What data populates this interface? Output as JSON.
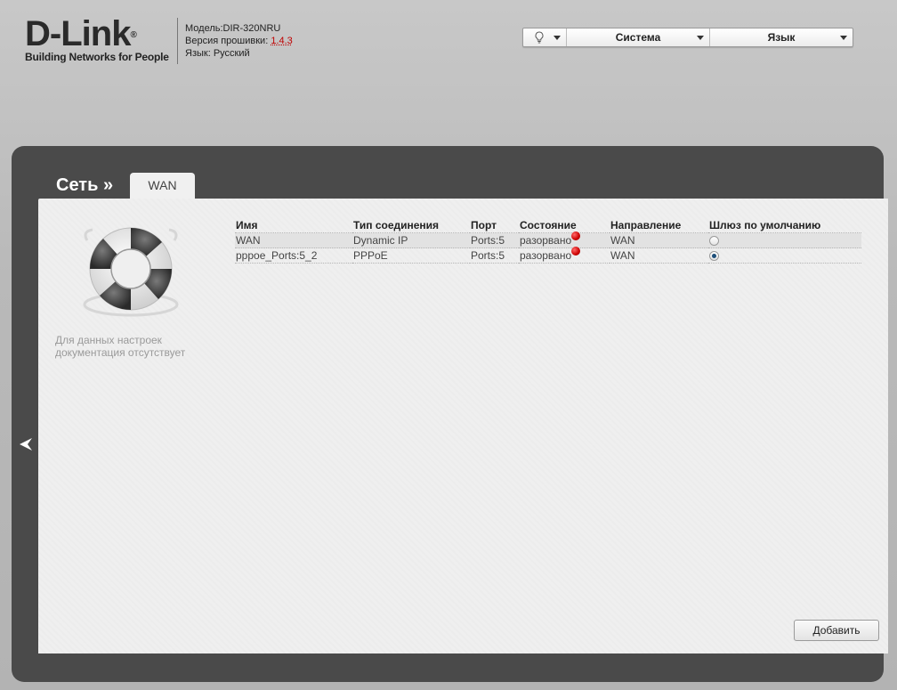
{
  "header": {
    "logo_text": "D-Link",
    "logo_reg": "®",
    "logo_tagline": "Building Networks for People",
    "model_label": "Модель:",
    "model_value": "DIR-320NRU",
    "firmware_label": "Версия прошивки: ",
    "firmware_value": "1.4.3",
    "language_label": "Язык: ",
    "language_value": "Русский"
  },
  "topmenu": {
    "bulb_icon": "lightbulb-icon",
    "system_label": "Система",
    "language_label": "Язык"
  },
  "breadcrumb": {
    "section": "Сеть »",
    "tab": "WAN"
  },
  "help": {
    "icon": "lifebuoy-icon",
    "text": "Для данных настроек документация отсутствует"
  },
  "table": {
    "columns": [
      "Имя",
      "Тип соединения",
      "Порт",
      "Состояние",
      "Направление",
      "Шлюз по умолчанию"
    ],
    "rows": [
      {
        "name": "WAN",
        "type": "Dynamic IP",
        "port": "Ports:5",
        "state": "разорвано",
        "direction": "WAN",
        "default_gw": false
      },
      {
        "name": "pppoe_Ports:5_2",
        "type": "PPPoE",
        "port": "Ports:5",
        "state": "разорвано",
        "direction": "WAN",
        "default_gw": true
      }
    ]
  },
  "buttons": {
    "add_label": "Добавить"
  },
  "colors": {
    "status_disconnected": "#cc0000",
    "panel": "#4a4a4a",
    "content": "#efefef"
  }
}
